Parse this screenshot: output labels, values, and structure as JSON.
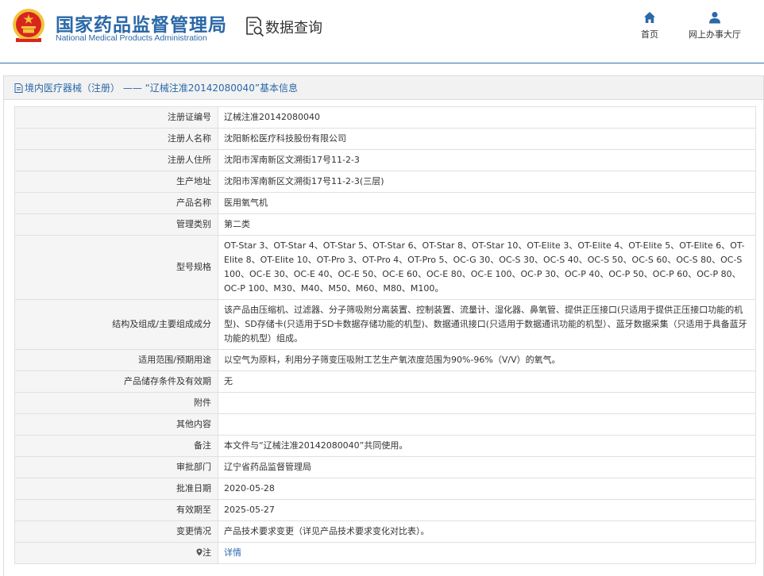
{
  "header": {
    "title_cn": "国家药品监督管理局",
    "title_en": "National Medical Products Administration",
    "query_label": "数据查询",
    "nav": [
      {
        "label": "首页",
        "icon": "home-icon"
      },
      {
        "label": "网上办事大厅",
        "icon": "user-icon"
      }
    ]
  },
  "panel": {
    "title": "境内医疗器械（注册） ——  “辽械注准20142080040”基本信息"
  },
  "rows": [
    {
      "key": "注册证编号",
      "value": "辽械注准20142080040"
    },
    {
      "key": "注册人名称",
      "value": "沈阳新松医疗科技股份有限公司"
    },
    {
      "key": "注册人住所",
      "value": "沈阳市浑南新区文溯街17号11-2-3"
    },
    {
      "key": "生产地址",
      "value": "沈阳市浑南新区文溯街17号11-2-3(三层)"
    },
    {
      "key": "产品名称",
      "value": "医用氧气机"
    },
    {
      "key": "管理类别",
      "value": "第二类"
    },
    {
      "key": "型号规格",
      "value": "OT-Star 3、OT-Star 4、OT-Star 5、OT-Star 6、OT-Star 8、OT-Star 10、OT-Elite 3、OT-Elite 4、OT-Elite 5、OT-Elite 6、OT-Elite 8、OT-Elite 10、OT-Pro 3、OT-Pro 4、OT-Pro 5、OC-G 30、OC-S 30、OC-S 40、OC-S 50、OC-S 60、OC-S 80、OC-S 100、OC-E 30、OC-E 40、OC-E 50、OC-E 60、OC-E 80、OC-E 100、OC-P 30、OC-P 40、OC-P 50、OC-P 60、OC-P 80、OC-P 100、M30、M40、M50、M60、M80、M100。"
    },
    {
      "key": "结构及组成/主要组成成分",
      "value": "该产品由压缩机、过滤器、分子筛吸附分离装置、控制装置、流量计、湿化器、鼻氧管、提供正压接口(只适用于提供正压接口功能的机型)、SD存储卡(只适用于SD卡数据存储功能的机型)、数据通讯接口(只适用于数据通讯功能的机型）、蓝牙数据采集（只适用于具备蓝牙功能的机型）组成。"
    },
    {
      "key": "适用范围/预期用途",
      "value": "以空气为原料，利用分子筛变压吸附工艺生产氧浓度范围为90%-96%（V/V）的氧气。"
    },
    {
      "key": "产品储存条件及有效期",
      "value": "无"
    },
    {
      "key": "附件",
      "value": ""
    },
    {
      "key": "其他内容",
      "value": ""
    },
    {
      "key": "备注",
      "value": "本文件与“辽械注准20142080040”共同使用。"
    },
    {
      "key": "审批部门",
      "value": "辽宁省药品监督管理局"
    },
    {
      "key": "批准日期",
      "value": "2020-05-28"
    },
    {
      "key": "有效期至",
      "value": "2025-05-27"
    },
    {
      "key": "变更情况",
      "value": "产品技术要求变更（详见产品技术要求变化对比表）。"
    },
    {
      "key": "注",
      "value": "详情",
      "icon": "location-pin-icon"
    }
  ],
  "colors": {
    "brand": "#2b68a8",
    "emblem_red": "#d8261f",
    "emblem_gold": "#f2c33b"
  }
}
